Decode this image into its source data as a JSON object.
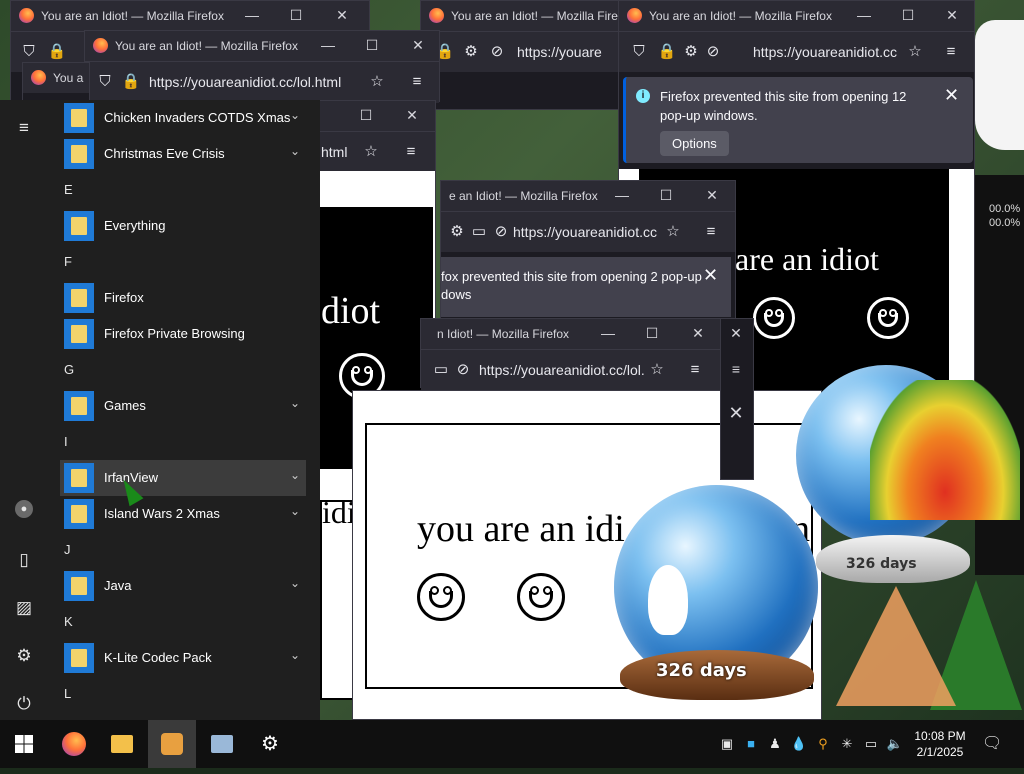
{
  "firefox": {
    "title": "You are an Idiot! — Mozilla Firefox",
    "title_short1": "e an Idiot! — Mozilla Firefox",
    "title_short2": "n Idiot! — Mozilla Firefox",
    "title_short3": "You a",
    "url_full": "https://youareanidiot.cc/lol.html",
    "url_trunc1": "https://youareanidiot.cc",
    "url_trunc2": "https://youareanidiot.cc/lol.",
    "url_trunc3": "https://youare",
    "url_trunc4": "html",
    "notify_12": "Firefox prevented this site from opening 12 pop-up windows.",
    "notify_2": "fox prevented this site from opening 2 pop-up",
    "notify_2b": "dows",
    "options_label": "Options",
    "minimize_glyph": "—",
    "maximize_glyph": "☐",
    "close_glyph": "✕",
    "menu_glyph": "≡",
    "star_glyph": "☆"
  },
  "page": {
    "idiot_text": "you are an idiot",
    "idiot_text_partial1": "you are an idi",
    "idiot_text_partial2": "u are an idiot",
    "idiot_text_partial3": "diot",
    "idiot_text_partial4": "idi",
    "idiot_text_partial5": "n"
  },
  "start_menu": {
    "rows": [
      {
        "type": "app",
        "label": "Chicken Invaders COTDS Xmas",
        "expand": true
      },
      {
        "type": "app",
        "label": "Christmas Eve Crisis",
        "expand": true
      },
      {
        "type": "letter",
        "label": "E"
      },
      {
        "type": "app",
        "label": "Everything",
        "expand": false
      },
      {
        "type": "letter",
        "label": "F"
      },
      {
        "type": "app",
        "label": "Firefox",
        "expand": false
      },
      {
        "type": "app",
        "label": "Firefox Private Browsing",
        "expand": false
      },
      {
        "type": "letter",
        "label": "G"
      },
      {
        "type": "app",
        "label": "Games",
        "expand": true
      },
      {
        "type": "letter",
        "label": "I"
      },
      {
        "type": "app",
        "label": "IrfanView",
        "expand": true,
        "selected": true
      },
      {
        "type": "app",
        "label": "Island Wars 2 Xmas",
        "expand": true
      },
      {
        "type": "letter",
        "label": "J"
      },
      {
        "type": "app",
        "label": "Java",
        "expand": true
      },
      {
        "type": "letter",
        "label": "K"
      },
      {
        "type": "app",
        "label": "K-Lite Codec Pack",
        "expand": true
      },
      {
        "type": "letter",
        "label": "L"
      }
    ],
    "rail": [
      "hamburger-icon",
      "user-icon",
      "documents-icon",
      "pictures-icon",
      "settings-icon",
      "power-icon"
    ]
  },
  "taskbar": {
    "clock_time": "10:08 PM",
    "clock_date": "2/1/2025",
    "pinned": [
      "start-icon",
      "firefox-icon",
      "file-explorer-icon",
      "app-icon",
      "remote-icon",
      "settings-icon"
    ]
  },
  "widgets": {
    "globe_days": "326 days",
    "percent1": "00.0%",
    "percent2": "00.0%"
  },
  "colors": {
    "firefox_chrome": "#2b2a33",
    "start_bg": "#1f1f1f",
    "tile_blue": "#1f7ad6",
    "taskbar_bg": "#101010",
    "notify_accent": "#0060df"
  }
}
